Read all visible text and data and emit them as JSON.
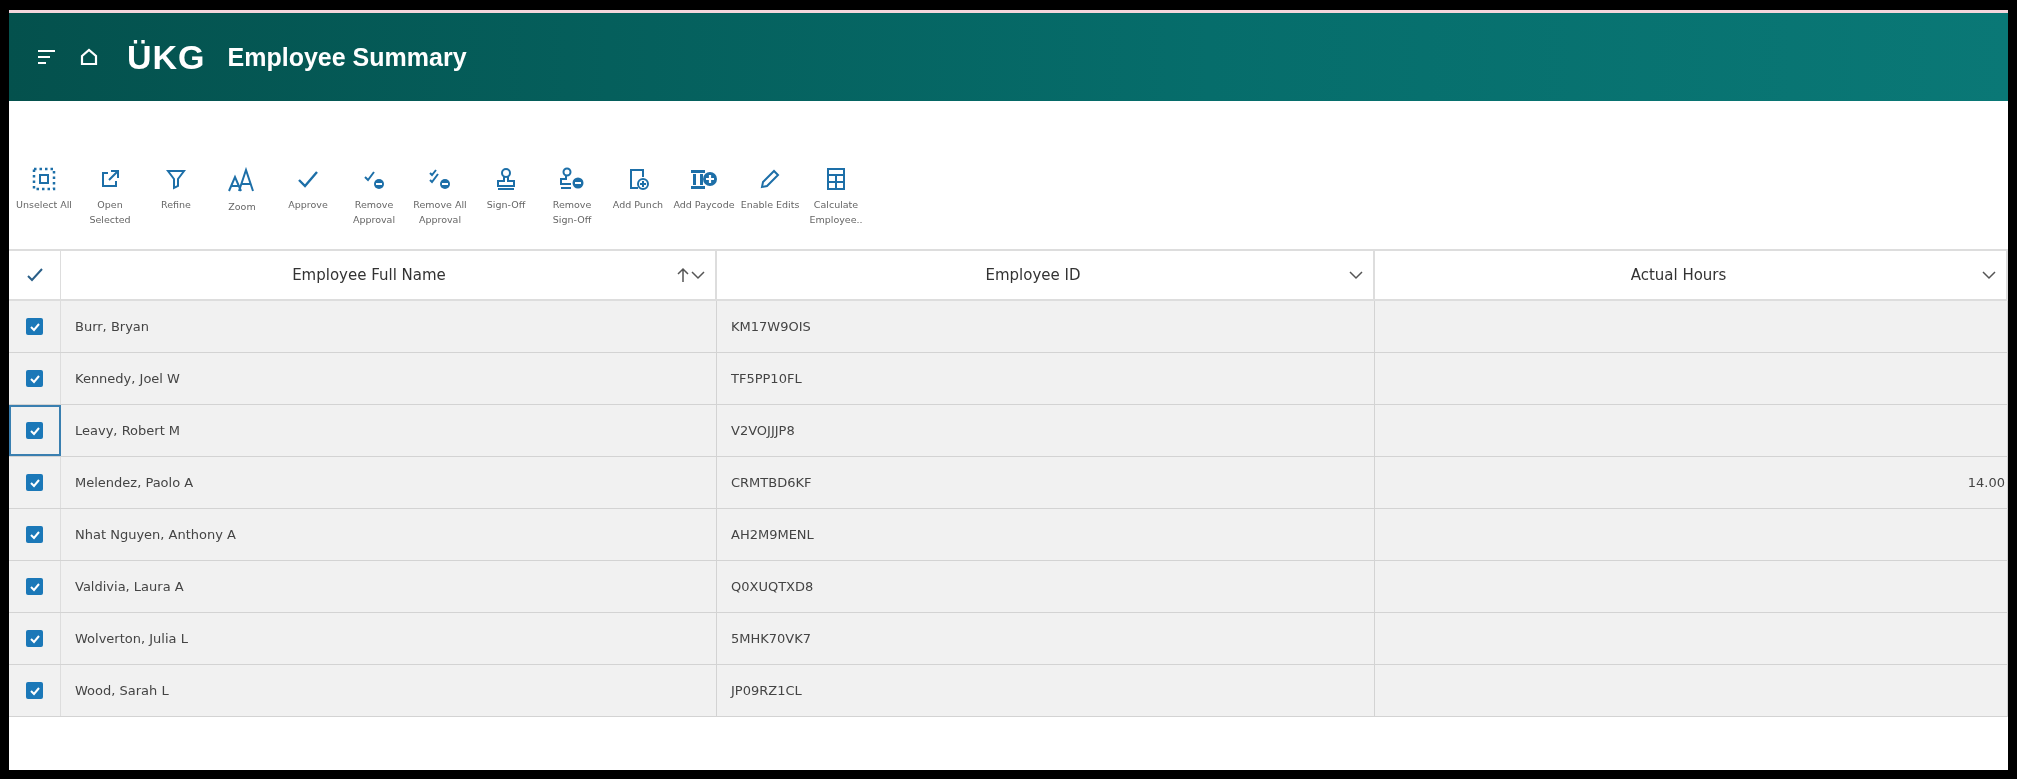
{
  "header": {
    "logo": "ÜKG",
    "title": "Employee Summary"
  },
  "toolbar": [
    {
      "label": "Unselect All"
    },
    {
      "label": "Open Selected"
    },
    {
      "label": "Refine"
    },
    {
      "label": "Zoom"
    },
    {
      "label": "Approve"
    },
    {
      "label": "Remove Approval"
    },
    {
      "label": "Remove All Approval"
    },
    {
      "label": "Sign-Off"
    },
    {
      "label": "Remove Sign-Off"
    },
    {
      "label": "Add Punch"
    },
    {
      "label": "Add Paycode"
    },
    {
      "label": "Enable Edits"
    },
    {
      "label": "Calculate Employee.."
    }
  ],
  "table": {
    "all_checked": true,
    "columns": [
      {
        "label": "Employee Full Name",
        "sorted_ascending": true
      },
      {
        "label": "Employee ID",
        "sorted_ascending": false
      },
      {
        "label": "Actual Hours",
        "sorted_ascending": false
      }
    ],
    "rows": [
      {
        "checked": true,
        "focused": false,
        "cells": [
          "Burr, Bryan",
          "KM17W9OIS",
          ""
        ]
      },
      {
        "checked": true,
        "focused": false,
        "cells": [
          "Kennedy, Joel W",
          "TF5PP10FL",
          ""
        ]
      },
      {
        "checked": true,
        "focused": true,
        "cells": [
          "Leavy, Robert M",
          "V2VOJJJP8",
          ""
        ]
      },
      {
        "checked": true,
        "focused": false,
        "cells": [
          "Melendez, Paolo A",
          "CRMTBD6KF",
          "14.00"
        ]
      },
      {
        "checked": true,
        "focused": false,
        "cells": [
          "Nhat Nguyen, Anthony A",
          "AH2M9MENL",
          ""
        ]
      },
      {
        "checked": true,
        "focused": false,
        "cells": [
          "Valdivia, Laura A",
          "Q0XUQTXD8",
          ""
        ]
      },
      {
        "checked": true,
        "focused": false,
        "cells": [
          "Wolverton, Julia L",
          "5MHK70VK7",
          ""
        ]
      },
      {
        "checked": true,
        "focused": false,
        "cells": [
          "Wood, Sarah L",
          "JP09RZ1CL",
          ""
        ]
      }
    ]
  }
}
